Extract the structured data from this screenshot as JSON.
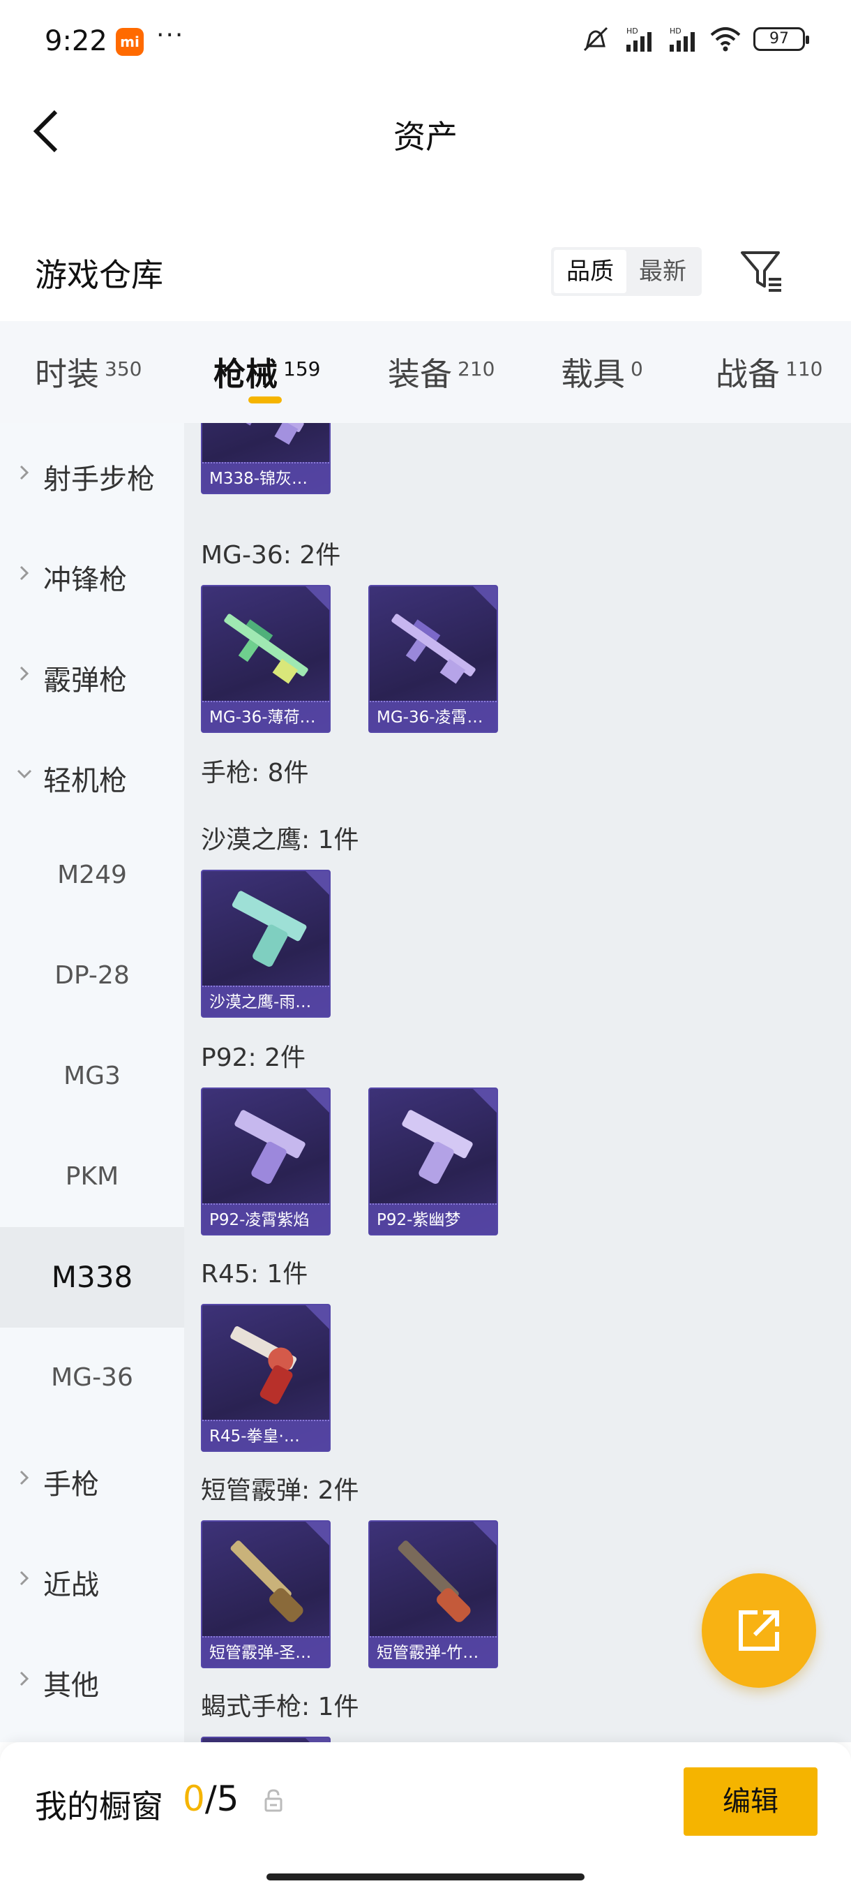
{
  "status_bar": {
    "time": "9:22",
    "mi_badge": "mi",
    "dots": "···",
    "battery": "97"
  },
  "header": {
    "title": "资产"
  },
  "warehouse": {
    "title": "游戏仓库",
    "sort_options": [
      "品质",
      "最新"
    ]
  },
  "tabs": [
    {
      "label": "时装",
      "count": "350"
    },
    {
      "label": "枪械",
      "count": "159"
    },
    {
      "label": "装备",
      "count": "210"
    },
    {
      "label": "载具",
      "count": "0"
    },
    {
      "label": "战备",
      "count": "110"
    }
  ],
  "sidebar": {
    "items": [
      "射手步枪",
      "冲锋枪",
      "霰弹枪",
      "轻机枪"
    ],
    "sub_items": [
      "M249",
      "DP-28",
      "MG3",
      "PKM",
      "M338",
      "MG-36"
    ],
    "tail_items": [
      "手枪",
      "近战",
      "其他"
    ]
  },
  "content": {
    "top_card": "M338-锦灰…",
    "groups": [
      {
        "title": "MG-36: 2件",
        "cards": [
          "MG-36-薄荷…",
          "MG-36-凌霄…"
        ]
      },
      {
        "title": "手枪: 8件"
      },
      {
        "title": "沙漠之鹰: 1件",
        "cards": [
          "沙漠之鹰-雨…"
        ]
      },
      {
        "title": "P92: 2件",
        "cards": [
          "P92-凌霄紫焰",
          "P92-紫幽梦"
        ]
      },
      {
        "title": "R45: 1件",
        "cards": [
          "R45-拳皇·…"
        ]
      },
      {
        "title": "短管霰弹: 2件",
        "cards": [
          "短管霰弹-圣…",
          "短管霰弹-竹…"
        ]
      },
      {
        "title": "蝎式手枪: 1件"
      }
    ]
  },
  "bottom_bar": {
    "title": "我的橱窗",
    "current": "0",
    "total": "/5",
    "edit_label": "编辑"
  },
  "colors": {
    "accent": "#f5b400",
    "card_bg": "#2a2252"
  }
}
